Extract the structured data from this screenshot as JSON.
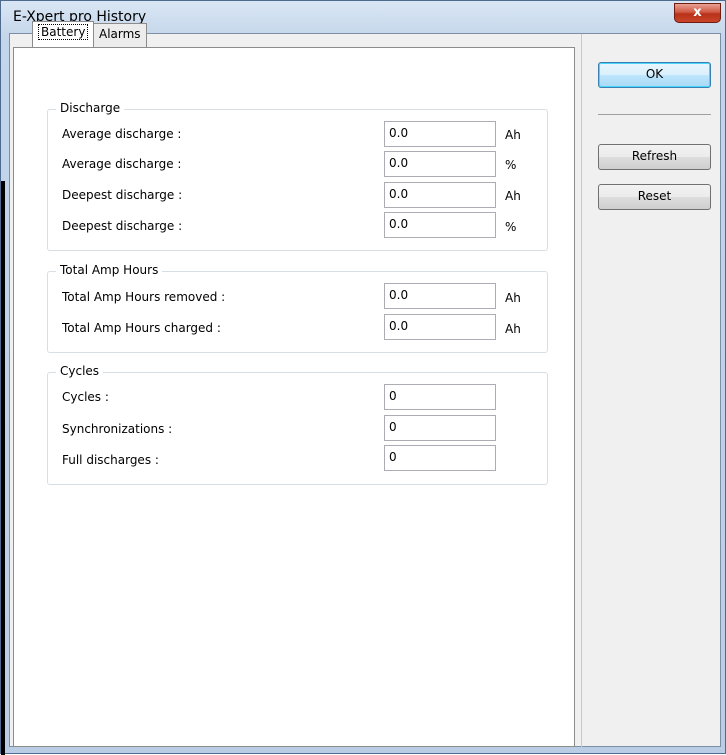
{
  "window": {
    "title": "E-Xpert pro History",
    "close_glyph": "x"
  },
  "tabs": [
    {
      "label": "Battery",
      "active": true
    },
    {
      "label": "Alarms",
      "active": false
    }
  ],
  "groups": {
    "discharge": {
      "legend": "Discharge",
      "rows": [
        {
          "label": "Average discharge :",
          "value": "0.0",
          "unit": "Ah"
        },
        {
          "label": "Average discharge :",
          "value": "0.0",
          "unit": "%"
        },
        {
          "label": "Deepest discharge :",
          "value": "0.0",
          "unit": "Ah"
        },
        {
          "label": "Deepest discharge :",
          "value": "0.0",
          "unit": "%"
        }
      ]
    },
    "amp_hours": {
      "legend": "Total Amp Hours",
      "rows": [
        {
          "label": "Total Amp Hours removed :",
          "value": "0.0",
          "unit": "Ah"
        },
        {
          "label": "Total Amp Hours charged :",
          "value": "0.0",
          "unit": "Ah"
        }
      ]
    },
    "cycles": {
      "legend": "Cycles",
      "rows": [
        {
          "label": "Cycles :",
          "value": "0"
        },
        {
          "label": "Synchronizations :",
          "value": "0"
        },
        {
          "label": "Full discharges :",
          "value": "0"
        }
      ]
    }
  },
  "buttons": {
    "ok": "OK",
    "refresh": "Refresh",
    "reset": "Reset"
  }
}
